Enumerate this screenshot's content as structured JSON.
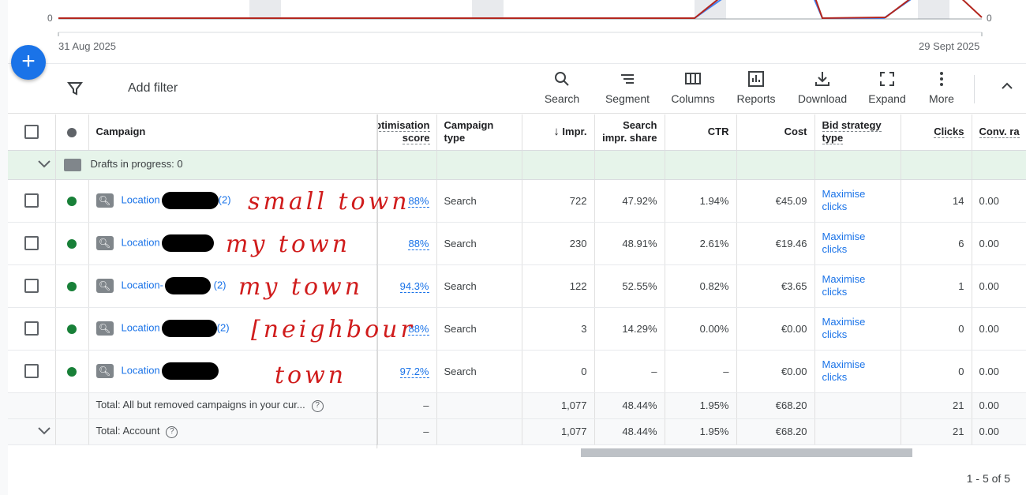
{
  "chart": {
    "axis_left_zero": "0",
    "axis_right_zero": "0",
    "start_date": "31 Aug 2025",
    "end_date": "29 Sept 2025"
  },
  "toolbar": {
    "add_filter": "Add filter",
    "tools": [
      {
        "label": "Search",
        "icon": "search-icon"
      },
      {
        "label": "Segment",
        "icon": "segment-icon"
      },
      {
        "label": "Columns",
        "icon": "columns-icon"
      },
      {
        "label": "Reports",
        "icon": "reports-icon"
      },
      {
        "label": "Download",
        "icon": "download-icon"
      },
      {
        "label": "Expand",
        "icon": "expand-icon"
      },
      {
        "label": "More",
        "icon": "more-icon"
      }
    ]
  },
  "table": {
    "headers": {
      "campaign": "Campaign",
      "opt_score": "Optimisation score",
      "opt_score_line1": "ptimisation",
      "opt_score_line2": "score",
      "type_line1": "Campaign",
      "type_line2": "type",
      "impr": "Impr.",
      "sis_line1": "Search",
      "sis_line2": "impr. share",
      "ctr": "CTR",
      "cost": "Cost",
      "bid_line1": "Bid strategy",
      "bid_line2": "type",
      "clicks": "Clicks",
      "conv": "Conv. ra"
    },
    "drafts": "Drafts in progress: 0",
    "rows": [
      {
        "name": "Location",
        "count": "(2)",
        "score": "88%",
        "type": "Search",
        "impr": "722",
        "sis": "47.92%",
        "ctr": "1.94%",
        "cost": "€45.09",
        "bid1": "Maximise",
        "bid2": "clicks",
        "clicks": "14",
        "conv": "0.00"
      },
      {
        "name": "Location",
        "count": "",
        "score": "88%",
        "type": "Search",
        "impr": "230",
        "sis": "48.91%",
        "ctr": "2.61%",
        "cost": "€19.46",
        "bid1": "Maximise",
        "bid2": "clicks",
        "clicks": "6",
        "conv": "0.00"
      },
      {
        "name": "Location-",
        "count": "(2)",
        "score": "94.3%",
        "type": "Search",
        "impr": "122",
        "sis": "52.55%",
        "ctr": "0.82%",
        "cost": "€3.65",
        "bid1": "Maximise",
        "bid2": "clicks",
        "clicks": "1",
        "conv": "0.00"
      },
      {
        "name": "Location",
        "count": "(2)",
        "score": "88%",
        "type": "Search",
        "impr": "3",
        "sis": "14.29%",
        "ctr": "0.00%",
        "cost": "€0.00",
        "bid1": "Maximise",
        "bid2": "clicks",
        "clicks": "0",
        "conv": "0.00"
      },
      {
        "name": "Location",
        "count": "",
        "score": "97.2%",
        "type": "Search",
        "impr": "0",
        "sis": "–",
        "ctr": "–",
        "cost": "€0.00",
        "bid1": "Maximise",
        "bid2": "clicks",
        "clicks": "0",
        "conv": "0.00"
      }
    ],
    "totals": [
      {
        "label": "Total: All but removed campaigns in your cur...",
        "score": "–",
        "impr": "1,077",
        "sis": "48.44%",
        "ctr": "1.95%",
        "cost": "€68.20",
        "clicks": "21",
        "conv": "0.00"
      },
      {
        "label": "Total: Account",
        "score": "–",
        "impr": "1,077",
        "sis": "48.44%",
        "ctr": "1.95%",
        "cost": "€68.20",
        "clicks": "21",
        "conv": "0.00"
      }
    ]
  },
  "annotations": {
    "row1": "small town",
    "row2": "my town",
    "row3": "my town",
    "row4": "[neighbour",
    "row5": "town"
  },
  "pagination": "1 - 5 of 5",
  "colors": {
    "accent": "#1a73e8",
    "status": "#188038",
    "annotation": "#d01c1c",
    "series_blue": "#4285f4",
    "series_red": "#b3261e"
  }
}
